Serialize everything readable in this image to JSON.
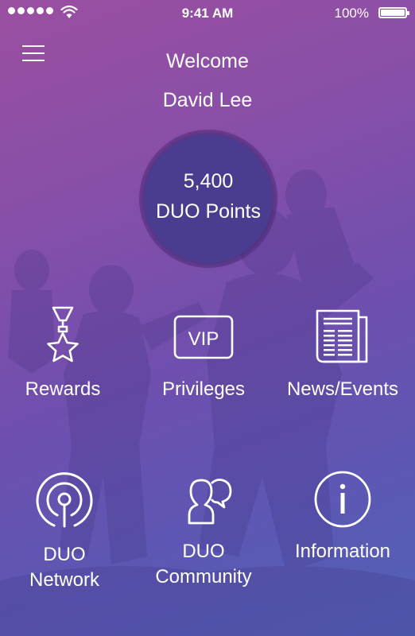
{
  "status_bar": {
    "time": "9:41 AM",
    "battery": "100%",
    "signal_icon": "signal-dots-icon",
    "wifi_icon": "wifi-icon",
    "battery_icon": "battery-icon"
  },
  "header": {
    "menu_icon": "hamburger-menu-icon",
    "welcome": "Welcome",
    "user_name": "David Lee"
  },
  "points": {
    "value": "5,400",
    "label": "DUO Points"
  },
  "menu": {
    "rewards": {
      "label": "Rewards",
      "icon": "medal-star-icon"
    },
    "privileges": {
      "label": "Privileges",
      "icon": "vip-card-icon"
    },
    "news": {
      "label": "News/Events",
      "icon": "newspaper-icon"
    },
    "network": {
      "label_line1": "DUO",
      "label_line2": "Network",
      "icon": "broadcast-antenna-icon"
    },
    "community": {
      "label_line1": "DUO",
      "label_line2": "Community",
      "icon": "people-chat-icon"
    },
    "information": {
      "label": "Information",
      "icon": "info-icon"
    }
  },
  "colors": {
    "gradient_top": "#9a4fa0",
    "gradient_bottom": "#5361b6",
    "points_circle": "#4a3c8e",
    "text": "#ffffff"
  }
}
